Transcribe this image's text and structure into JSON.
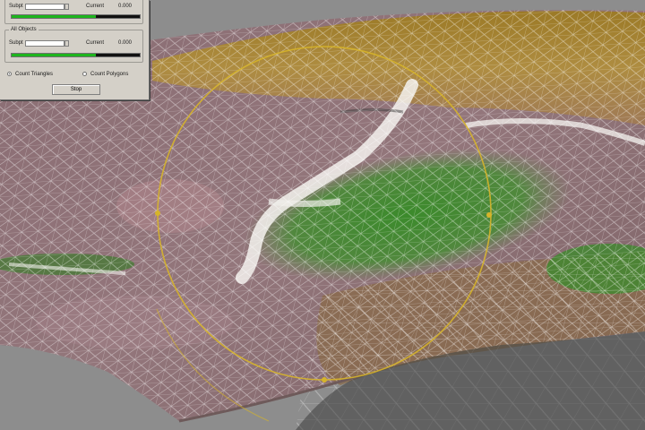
{
  "panel": {
    "group1": {
      "title": "",
      "label_left": "Subpt",
      "value": "",
      "label_mid": "Current",
      "value_right": "0.000",
      "progress": 0.66
    },
    "group2": {
      "title": "All Objects",
      "label_left": "Subpt",
      "value": "",
      "label_mid": "Current",
      "value_right": "0.000",
      "progress": 0.66
    },
    "radio1_label": "Count Triangles",
    "radio2_label": "Count Polygons",
    "stop_label": "Stop"
  },
  "colors": {
    "panel_bg": "#d4d0c8",
    "progress_fill": "#1db51d",
    "gizmo": "#d6b42a",
    "wireframe": "#ffffff",
    "terrain_green": "#3f8a2e",
    "terrain_mauve": "#8a6d73"
  },
  "viewport": {
    "content": "3D terrain mesh with wireframe overlay and circular selection gizmo"
  }
}
